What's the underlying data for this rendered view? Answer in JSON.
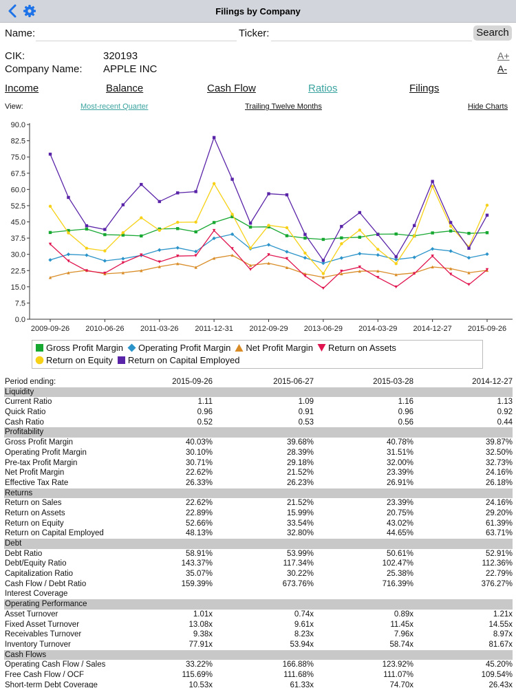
{
  "nav": {
    "title": "Filings by Company",
    "back_icon": "chevron-left-icon",
    "settings_icon": "gear-icon",
    "accent": "#1e73e8"
  },
  "search": {
    "name_label": "Name:",
    "name_value": "",
    "ticker_label": "Ticker:",
    "ticker_value": "",
    "button_label": "Search"
  },
  "company": {
    "cik_label": "CIK:",
    "cik_value": "320193",
    "name_label": "Company Name:",
    "name_value": "APPLE INC"
  },
  "font_controls": {
    "increase": "A+",
    "decrease": "A-"
  },
  "tabs": [
    {
      "label": "Income",
      "active": false
    },
    {
      "label": "Balance",
      "active": false
    },
    {
      "label": "Cash Flow",
      "active": false
    },
    {
      "label": "Ratios",
      "active": true
    },
    {
      "label": "Filings",
      "active": false
    }
  ],
  "view": {
    "label": "View:",
    "quarter": "Most-recent Quarter",
    "ttm": "Trailing Twelve Months",
    "hide": "Hide Charts",
    "active_color": "#3aa39f"
  },
  "chart_data": {
    "type": "line",
    "ylim": [
      0,
      90
    ],
    "yticks": [
      "0.0",
      "7.5",
      "15.0",
      "22.5",
      "30.0",
      "37.5",
      "45.0",
      "52.5",
      "60.0",
      "67.5",
      "75.0",
      "82.5",
      "90.0"
    ],
    "xtick_labels": [
      "2009-09-26",
      "2010-06-26",
      "2011-03-26",
      "2011-12-31",
      "2012-09-29",
      "2013-06-29",
      "2014-03-29",
      "2014-12-27",
      "2015-09-26"
    ],
    "grid": false,
    "legend_position": "bottom",
    "series": [
      {
        "name": "Gross Profit Margin",
        "color": "#17a832",
        "marker": "square",
        "values": [
          40.1,
          41.0,
          41.7,
          39.1,
          38.9,
          38.5,
          41.7,
          41.9,
          40.4,
          44.7,
          47.4,
          42.6,
          42.7,
          38.6,
          37.5,
          36.9,
          37.6,
          37.9,
          39.3,
          39.4,
          38.5,
          39.9,
          40.8,
          39.7,
          40.0
        ]
      },
      {
        "name": "Operating Profit Margin",
        "color": "#2a93c9",
        "marker": "diamond",
        "values": [
          27.4,
          30.0,
          29.6,
          27.0,
          28.0,
          29.5,
          32.0,
          33.0,
          31.3,
          37.4,
          39.3,
          32.6,
          34.4,
          31.2,
          28.4,
          25.9,
          28.3,
          30.3,
          29.7,
          27.6,
          28.6,
          32.5,
          31.5,
          28.4,
          30.1
        ]
      },
      {
        "name": "Net Profit Margin",
        "color": "#d98c26",
        "marker": "triangle",
        "values": [
          19.3,
          21.5,
          22.6,
          21.0,
          21.5,
          22.5,
          24.3,
          25.7,
          24.0,
          28.2,
          29.6,
          24.9,
          25.9,
          23.9,
          21.0,
          19.4,
          21.0,
          22.2,
          22.3,
          20.6,
          21.4,
          24.2,
          23.4,
          21.5,
          22.6
        ]
      },
      {
        "name": "Return on Assets",
        "color": "#e0144e",
        "marker": "triangle-down",
        "values": [
          34.7,
          26.9,
          22.4,
          21.3,
          26.1,
          29.7,
          26.5,
          29.2,
          29.4,
          41.0,
          32.6,
          23.0,
          29.8,
          28.0,
          20.0,
          14.3,
          22.2,
          24.1,
          19.3,
          14.9,
          21.1,
          29.2,
          20.8,
          16.0,
          22.9
        ]
      },
      {
        "name": "Return on Equity",
        "color": "#f7d117",
        "marker": "circle",
        "values": [
          52.2,
          39.9,
          32.8,
          31.6,
          40.0,
          46.9,
          41.1,
          44.8,
          44.9,
          62.7,
          48.5,
          32.9,
          43.4,
          42.3,
          30.6,
          21.1,
          34.9,
          41.2,
          32.3,
          25.7,
          38.5,
          61.4,
          43.0,
          33.5,
          52.7
        ]
      },
      {
        "name": "Return on Capital Employed",
        "color": "#5a24a8",
        "marker": "square",
        "values": [
          76.3,
          56.3,
          43.2,
          41.5,
          52.9,
          62.3,
          54.4,
          58.4,
          59.0,
          84.0,
          64.7,
          44.4,
          58.0,
          57.5,
          39.2,
          27.2,
          42.9,
          49.3,
          39.2,
          28.9,
          43.3,
          63.7,
          44.7,
          32.8,
          48.1
        ]
      }
    ]
  },
  "table": {
    "period_label": "Period ending:",
    "periods": [
      "2015-09-26",
      "2015-06-27",
      "2015-03-28",
      "2014-12-27"
    ],
    "rows": [
      {
        "type": "section",
        "label": "Liquidity"
      },
      {
        "type": "row",
        "label": "Current Ratio",
        "values": [
          "1.11",
          "1.09",
          "1.16",
          "1.13"
        ]
      },
      {
        "type": "row",
        "label": "Quick Ratio",
        "values": [
          "0.96",
          "0.91",
          "0.96",
          "0.92"
        ]
      },
      {
        "type": "row",
        "label": "Cash Ratio",
        "values": [
          "0.52",
          "0.53",
          "0.56",
          "0.44"
        ]
      },
      {
        "type": "section",
        "label": "Profitability"
      },
      {
        "type": "row",
        "label": "Gross Profit Margin",
        "values": [
          "40.03%",
          "39.68%",
          "40.78%",
          "39.87%"
        ]
      },
      {
        "type": "row",
        "label": "Operating Profit Margin",
        "values": [
          "30.10%",
          "28.39%",
          "31.51%",
          "32.50%"
        ]
      },
      {
        "type": "row",
        "label": "Pre-tax Profit Margin",
        "values": [
          "30.71%",
          "29.18%",
          "32.00%",
          "32.73%"
        ]
      },
      {
        "type": "row",
        "label": "Net Profit Margin",
        "values": [
          "22.62%",
          "21.52%",
          "23.39%",
          "24.16%"
        ]
      },
      {
        "type": "row",
        "label": "Effective Tax Rate",
        "values": [
          "26.33%",
          "26.23%",
          "26.91%",
          "26.18%"
        ]
      },
      {
        "type": "section",
        "label": "Returns"
      },
      {
        "type": "row",
        "label": "Return on Sales",
        "values": [
          "22.62%",
          "21.52%",
          "23.39%",
          "24.16%"
        ]
      },
      {
        "type": "row",
        "label": "Return on Assets",
        "values": [
          "22.89%",
          "15.99%",
          "20.75%",
          "29.20%"
        ]
      },
      {
        "type": "row",
        "label": "Return on Equity",
        "values": [
          "52.66%",
          "33.54%",
          "43.02%",
          "61.39%"
        ]
      },
      {
        "type": "row",
        "label": "Return on Capital Employed",
        "values": [
          "48.13%",
          "32.80%",
          "44.65%",
          "63.71%"
        ]
      },
      {
        "type": "section",
        "label": "Debt"
      },
      {
        "type": "row",
        "label": "Debt Ratio",
        "values": [
          "58.91%",
          "53.99%",
          "50.61%",
          "52.91%"
        ]
      },
      {
        "type": "row",
        "label": "Debt/Equity Ratio",
        "values": [
          "143.37%",
          "117.34%",
          "102.47%",
          "112.36%"
        ]
      },
      {
        "type": "row",
        "label": "Capitalization Ratio",
        "values": [
          "35.07%",
          "30.22%",
          "25.38%",
          "22.79%"
        ]
      },
      {
        "type": "row",
        "label": "Cash Flow / Debt Ratio",
        "values": [
          "159.39%",
          "673.76%",
          "716.39%",
          "376.27%"
        ]
      },
      {
        "type": "row",
        "label": "Interest Coverage",
        "values": [
          "",
          "",
          "",
          ""
        ]
      },
      {
        "type": "section",
        "label": "Operating Performance"
      },
      {
        "type": "row",
        "label": "Asset Turnover",
        "values": [
          "1.01x",
          "0.74x",
          "0.89x",
          "1.21x"
        ]
      },
      {
        "type": "row",
        "label": "Fixed Asset Turnover",
        "values": [
          "13.08x",
          "9.61x",
          "11.45x",
          "14.55x"
        ]
      },
      {
        "type": "row",
        "label": "Receivables Turnover",
        "values": [
          "9.38x",
          "8.23x",
          "7.96x",
          "8.97x"
        ]
      },
      {
        "type": "row",
        "label": "Inventory Turnover",
        "values": [
          "77.91x",
          "53.94x",
          "58.74x",
          "81.67x"
        ]
      },
      {
        "type": "section",
        "label": "Cash Flows"
      },
      {
        "type": "row",
        "label": "Operating Cash Flow / Sales",
        "values": [
          "33.22%",
          "166.88%",
          "123.92%",
          "45.20%"
        ]
      },
      {
        "type": "row",
        "label": "Free Cash Flow / OCF",
        "values": [
          "115.69%",
          "111.68%",
          "111.07%",
          "109.54%"
        ]
      },
      {
        "type": "row",
        "label": "Short-term Debt Coverage",
        "values": [
          "10.53x",
          "61.33x",
          "74.70x",
          "26.43x"
        ]
      }
    ]
  }
}
